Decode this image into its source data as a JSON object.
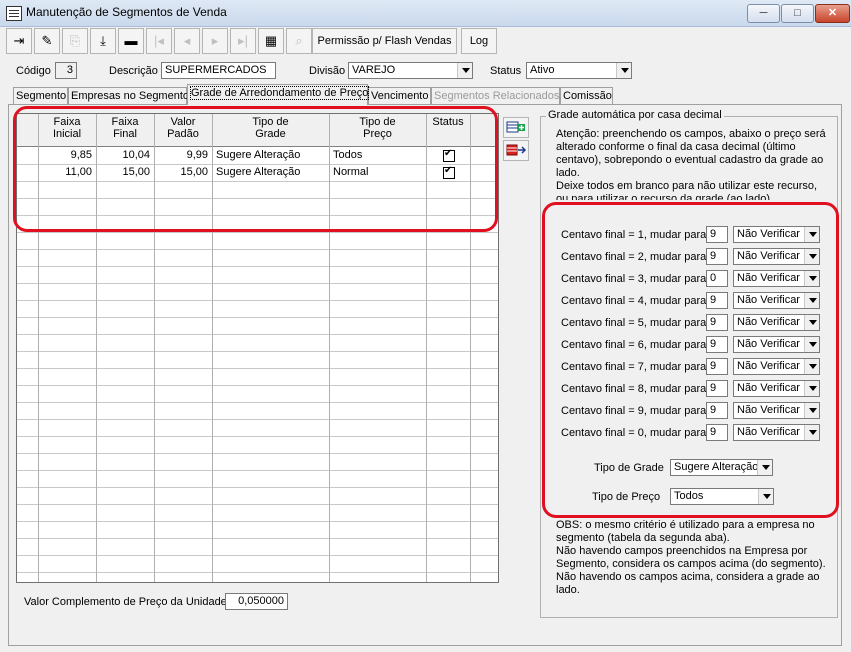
{
  "window": {
    "title": "Manutenção de Segmentos de Venda",
    "controls": {
      "minimize": "─",
      "maximize": "□",
      "close": "✕"
    }
  },
  "toolbar": {
    "buttons": [
      {
        "icon": "exit-door-icon",
        "glyph": "⇥",
        "enabled": true
      },
      {
        "icon": "pencil-edit-icon",
        "glyph": "✎",
        "enabled": true
      },
      {
        "icon": "copy-new-icon",
        "glyph": "⎘",
        "enabled": false
      },
      {
        "icon": "download-save-icon",
        "glyph": "⤓",
        "enabled": true
      },
      {
        "icon": "delete-record-icon",
        "glyph": "▬",
        "enabled": true
      },
      {
        "icon": "first-record-icon",
        "glyph": "|◂",
        "enabled": false
      },
      {
        "icon": "previous-record-icon",
        "glyph": "◂",
        "enabled": false
      },
      {
        "icon": "next-record-icon",
        "glyph": "▸",
        "enabled": false
      },
      {
        "icon": "last-record-icon",
        "glyph": "▸|",
        "enabled": false
      },
      {
        "icon": "film-grid-icon",
        "glyph": "▦",
        "enabled": true
      },
      {
        "icon": "binoculars-search-icon",
        "glyph": "⌕",
        "enabled": false
      }
    ],
    "permissao_label": "Permissão p/ Flash Vendas",
    "log_label": "Log"
  },
  "form": {
    "codigo_label": "Código",
    "codigo_value": "3",
    "descricao_label": "Descrição",
    "descricao_value": "SUPERMERCADOS",
    "divisao_label": "Divisão",
    "divisao_value": "VAREJO",
    "status_label": "Status",
    "status_value": "Ativo"
  },
  "tabs": [
    {
      "label": "Segmento",
      "state": "normal"
    },
    {
      "label": "Empresas no Segmento",
      "state": "normal"
    },
    {
      "label": "Grade de Arredondamento de Preço",
      "state": "active"
    },
    {
      "label": "Vencimento",
      "state": "normal"
    },
    {
      "label": "Segmentos Relacionados",
      "state": "disabled"
    },
    {
      "label": "Comissão",
      "state": "normal"
    }
  ],
  "grid": {
    "headers": [
      {
        "line1": "Faixa",
        "line2": "Inicial"
      },
      {
        "line1": "Faixa",
        "line2": "Final"
      },
      {
        "line1": "Valor",
        "line2": "Padão"
      },
      {
        "line1": "Tipo de",
        "line2": "Grade"
      },
      {
        "line1": "Tipo de",
        "line2": "Preço"
      },
      {
        "line1": "Status",
        "line2": ""
      }
    ],
    "rows": [
      {
        "faixa_inicial": "9,85",
        "faixa_final": "10,04",
        "valor_padrao": "9,99",
        "tipo_grade": "Sugere Alteração",
        "tipo_preco": "Todos",
        "status_checked": true
      },
      {
        "faixa_inicial": "11,00",
        "faixa_final": "15,00",
        "valor_padrao": "15,00",
        "tipo_grade": "Sugere Alteração",
        "tipo_preco": "Normal",
        "status_checked": true
      }
    ]
  },
  "side_buttons": [
    {
      "icon": "add-row-icon"
    },
    {
      "icon": "remove-row-icon"
    }
  ],
  "groupbox": {
    "title": "Grade automática por casa decimal",
    "info": "Atenção: preenchendo os campos, abaixo o preço será alterado conforme o final da casa decimal (último centavo), sobrepondo o eventual cadastro da grade ao lado.\nDeixe todos em branco para não utilizar este recurso, ou para utilizar o recurso da grade (ao lado).",
    "centavos": [
      {
        "label": "Centavo final = 1, mudar para",
        "value": "9",
        "option": "Não Verificar"
      },
      {
        "label": "Centavo final = 2, mudar para",
        "value": "9",
        "option": "Não Verificar"
      },
      {
        "label": "Centavo final = 3, mudar para",
        "value": "0",
        "option": "Não Verificar"
      },
      {
        "label": "Centavo final = 4, mudar para",
        "value": "9",
        "option": "Não Verificar"
      },
      {
        "label": "Centavo final = 5, mudar para",
        "value": "9",
        "option": "Não Verificar"
      },
      {
        "label": "Centavo final = 6, mudar para",
        "value": "9",
        "option": "Não Verificar"
      },
      {
        "label": "Centavo final = 7, mudar para",
        "value": "9",
        "option": "Não Verificar"
      },
      {
        "label": "Centavo final = 8, mudar para",
        "value": "9",
        "option": "Não Verificar"
      },
      {
        "label": "Centavo final = 9, mudar para",
        "value": "9",
        "option": "Não Verificar"
      },
      {
        "label": "Centavo final = 0, mudar para",
        "value": "9",
        "option": "Não Verificar"
      }
    ],
    "tipo_grade_label": "Tipo de Grade",
    "tipo_grade_value": "Sugere Alteração",
    "tipo_preco_label": "Tipo de Preço",
    "tipo_preco_value": "Todos",
    "obs": "OBS: o mesmo critério é utilizado para a empresa no segmento (tabela da segunda aba).\nNão havendo campos preenchidos na Empresa por Segmento, considera os campos acima (do segmento).\nNão havendo os campos acima, considera a grade ao lado."
  },
  "footer": {
    "valor_complemento_label": "Valor Complemento de Preço da Unidade",
    "valor_complemento_value": "0,050000"
  },
  "colors": {
    "highlight": "#e01020",
    "window_bg": "#f0f0f0"
  }
}
